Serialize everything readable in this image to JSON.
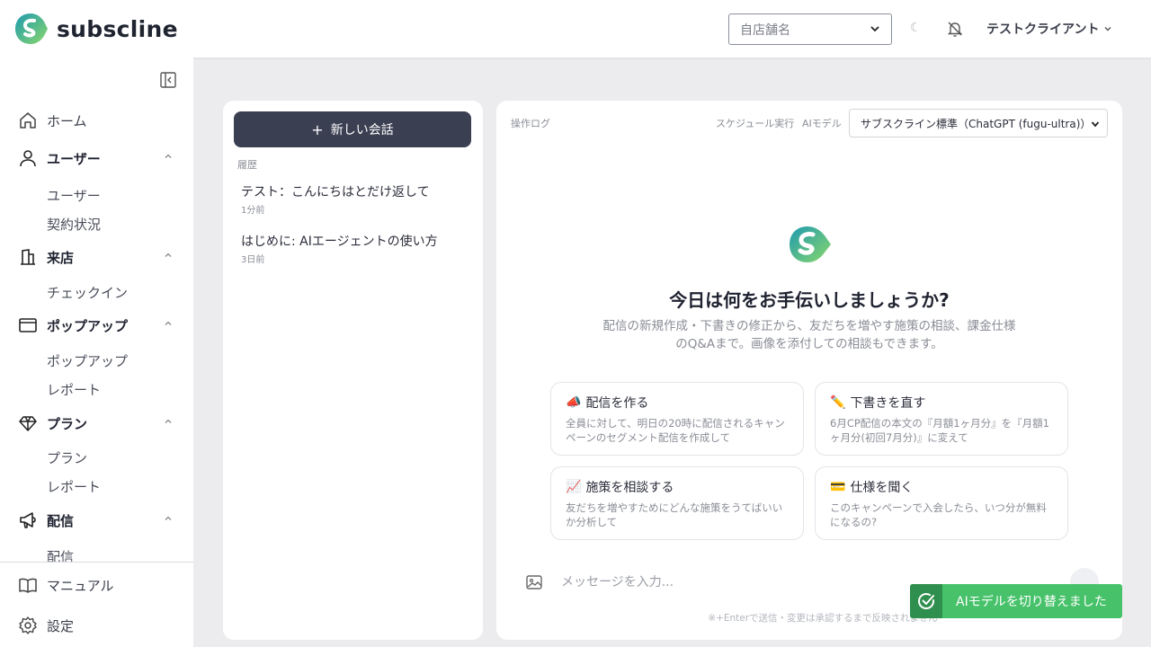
{
  "header": {
    "brand": "subscline",
    "store_placeholder": "自店舗名",
    "moon_glyph": "☾",
    "user_name": "テストクライアント"
  },
  "sidebar": {
    "home": "ホーム",
    "users_group": "ユーザー",
    "users_items": [
      "ユーザー",
      "契約状況"
    ],
    "visit_group": "来店",
    "visit_items": [
      "チェックイン"
    ],
    "popup_group": "ポップアップ",
    "popup_items": [
      "ポップアップ",
      "レポート"
    ],
    "plan_group": "プラン",
    "plan_items": [
      "プラン",
      "レポート"
    ],
    "delivery_group": "配信",
    "delivery_items": [
      "配信"
    ],
    "manual": "マニュアル",
    "settings": "設定"
  },
  "history": {
    "new_chat_label": "新しい会話",
    "section_label": "履歴",
    "items": [
      {
        "title": "テスト：こんにちはとだけ返して",
        "time": "1分前"
      },
      {
        "title": "はじめに: AIエージェントの使い方",
        "time": "3日前"
      }
    ]
  },
  "main": {
    "oplog_label": "操作ログ",
    "schedule_label": "スケジュール実行",
    "ai_model_label": "AIモデル",
    "model_value": "サブスクライン標準（ChatGPT (fugu-ultra)）",
    "hero_title": "今日は何をお手伝いしましょうか?",
    "hero_sub": "配信の新規作成・下書きの修正から、友だちを増やす施策の相談、課金仕様のQ&Aまで。画像を添付しての相談もできます。",
    "cards": [
      {
        "emoji": "📣",
        "title": "配信を作る",
        "desc": "全員に対して、明日の20時に配信されるキャンペーンのセグメント配信を作成して"
      },
      {
        "emoji": "✏️",
        "title": "下書きを直す",
        "desc": "6月CP配信の本文の『月額1ヶ月分』を『月額1ヶ月分(初回7月分)』に変えて"
      },
      {
        "emoji": "📈",
        "title": "施策を相談する",
        "desc": "友だちを増やすためにどんな施策をうてばいいか分析して"
      },
      {
        "emoji": "💳",
        "title": "仕様を聞く",
        "desc": "このキャンペーンで入会したら、いつ分が無料になるの?"
      }
    ],
    "input_placeholder": "メッセージを入力...",
    "hint": "※+Enterで送信・変更は承認するまで反映されません"
  },
  "toast": {
    "message": "AIモデルを切り替えました"
  },
  "colors": {
    "brand_teal": "#2aa8a0",
    "brand_green": "#7cd46a",
    "dark_button": "#3b3f52",
    "toast_green": "#47c26a"
  }
}
